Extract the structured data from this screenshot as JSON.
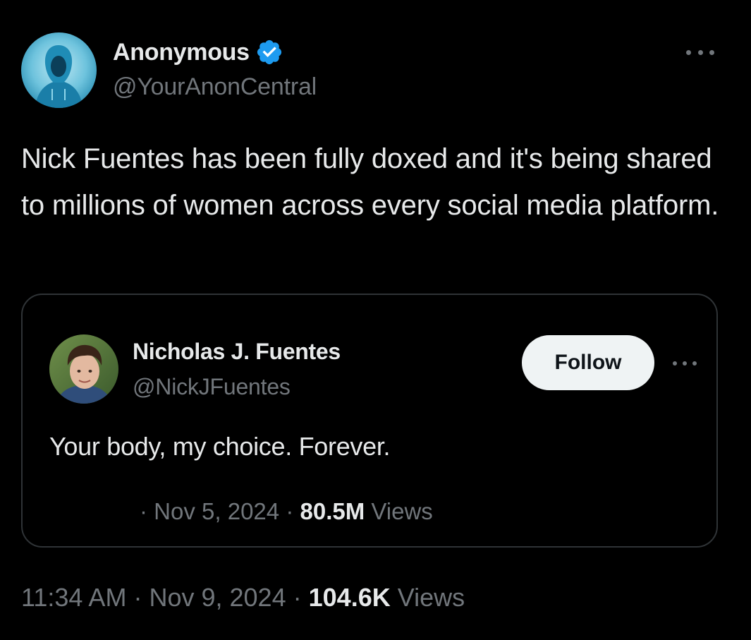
{
  "tweet": {
    "author": {
      "name": "Anonymous",
      "handle": "@YourAnonCentral",
      "verified": true,
      "avatar_icon": "hooded-figure-avatar"
    },
    "text": "Nick Fuentes has been fully doxed and it's being shared to millions of women across every social media platform.",
    "time": "11:34 AM",
    "separator": "·",
    "date": "Nov 9, 2024",
    "views_count": "104.6K",
    "views_label": "Views",
    "more_icon": "more-horizontal-icon"
  },
  "quote": {
    "author": {
      "name": "Nicholas J. Fuentes",
      "handle": "@NickJFuentes",
      "avatar_icon": "profile-photo-avatar"
    },
    "follow_label": "Follow",
    "text": "Your body, my choice. Forever.",
    "separator": "·",
    "date": "Nov 5, 2024",
    "views_count": "80.5M",
    "views_label": "Views",
    "more_icon": "more-horizontal-icon"
  },
  "colors": {
    "background": "#000000",
    "text_primary": "#e7e9ea",
    "text_secondary": "#71767b",
    "border": "#2f3336",
    "verified_badge": "#1d9bf0",
    "follow_button_bg": "#eff3f4"
  }
}
